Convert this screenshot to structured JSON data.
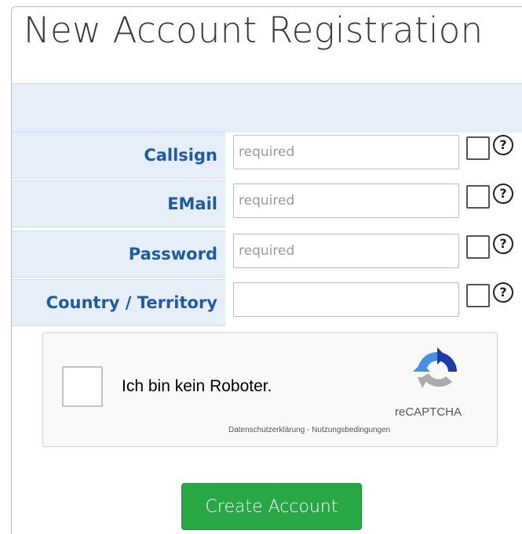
{
  "page": {
    "title": "New Account Registration"
  },
  "form": {
    "rows": [
      {
        "label": "Callsign",
        "value": "",
        "placeholder": "required"
      },
      {
        "label": "EMail",
        "value": "",
        "placeholder": "required"
      },
      {
        "label": "Password",
        "value": "",
        "placeholder": "required"
      },
      {
        "label": "Country / Territory",
        "value": "",
        "placeholder": ""
      }
    ],
    "help_glyph": "?"
  },
  "captcha": {
    "label": "Ich bin kein Roboter.",
    "brand": "reCAPTCHA",
    "links": "Datenschutzerklärung - Nutzungsbedingungen",
    "icon": "recaptcha-logo-icon"
  },
  "actions": {
    "create_label": "Create Account"
  },
  "colors": {
    "label_text": "#1f5aa6",
    "label_bg": "#e6eef8",
    "button_bg": "#28a745",
    "title_text": "#3a3a3a"
  }
}
